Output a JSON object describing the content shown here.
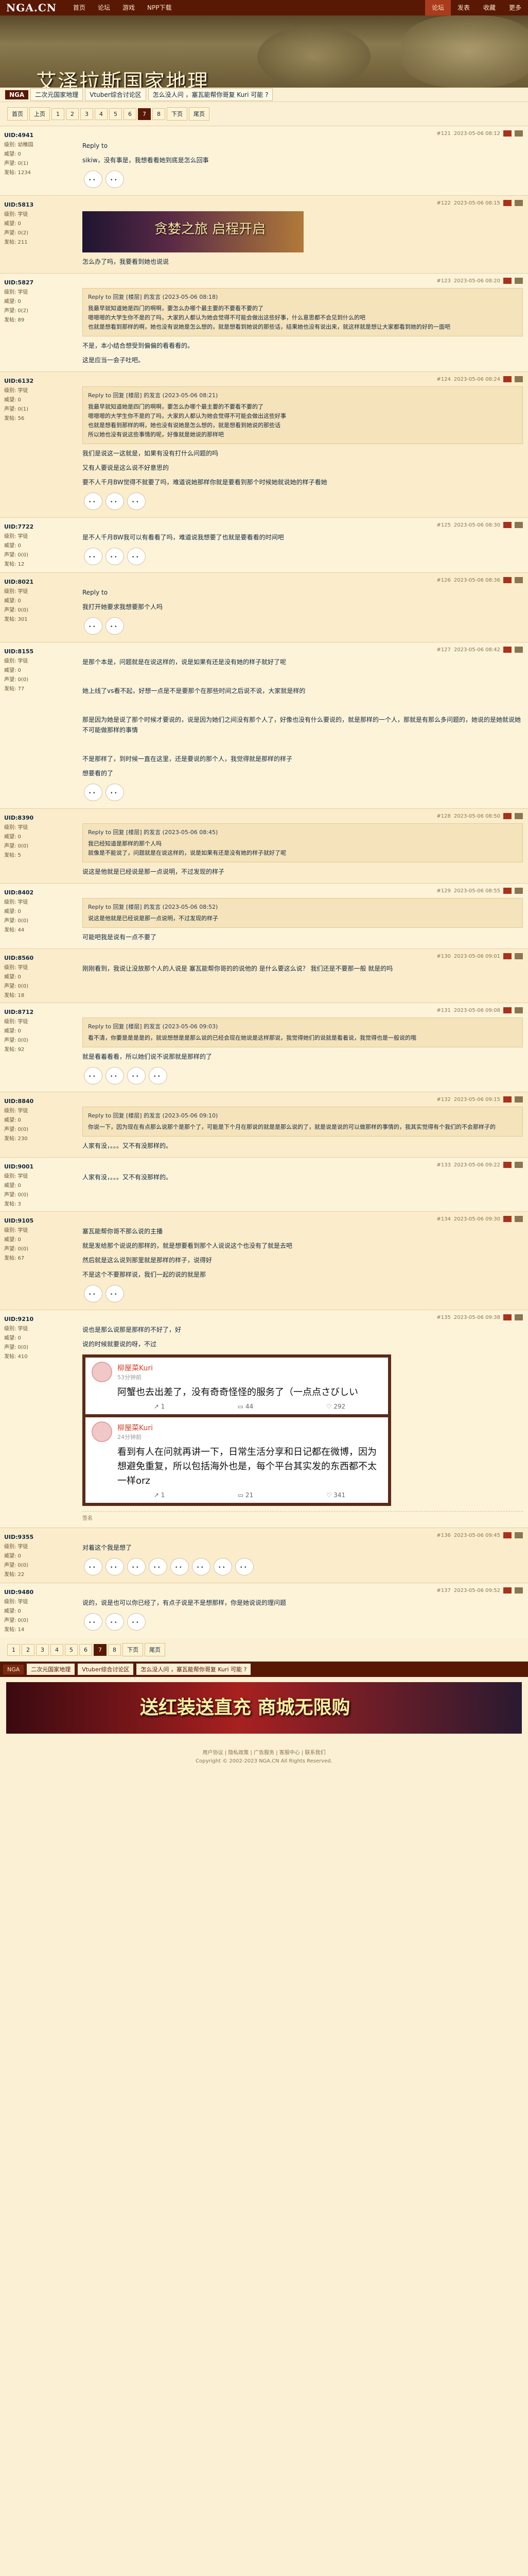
{
  "top": {
    "logo": "NGA.CN",
    "nav": [
      "首页",
      "论坛",
      "游戏",
      "NPP下载"
    ],
    "right": [
      "论坛",
      "发表",
      "收藏",
      "更多"
    ]
  },
  "banner": {
    "title": "艾泽拉斯国家地理"
  },
  "crumbs": {
    "home": "NGA",
    "items": [
      "二次元国家地理",
      "Vtuber综合讨论区",
      "怎么没人问 ，塞瓦能帮你哥复 Kuri 可能 ?"
    ]
  },
  "pager": [
    "首页",
    "上页",
    "1",
    "2",
    "3",
    "4",
    "5",
    "6",
    "7",
    "8",
    "下页",
    "尾页"
  ],
  "pager_current": "7",
  "posts": [
    {
      "uid": "UID:4941",
      "level": "级别: 幼稚园",
      "rep": "威望: 0",
      "prestige": "声望: 0(1)",
      "posts_count": "发帖: 1234",
      "floor": "#121",
      "time": "2023-05-06 08:12",
      "reply_to": "Reply to",
      "body": "sikiw，没有事是，我想看看她到底是怎么回事",
      "emos": 2
    },
    {
      "uid": "UID:5813",
      "level": "级别: 学徒",
      "rep": "威望: 0",
      "prestige": "声望: 0(2)",
      "posts_count": "发帖: 211",
      "floor": "#122",
      "time": "2023-05-06 08:15",
      "body": "怎么办了吗，我要看到她也说说",
      "emos": 0
    },
    {
      "uid": "UID:5827",
      "level": "级别: 学徒",
      "rep": "威望: 0",
      "prestige": "声望: 0(2)",
      "posts_count": "发帖: 89",
      "floor": "#123",
      "time": "2023-05-06 08:20",
      "quote_head": "Reply to 回复 [楼层] 的发言 (2023-05-06 08:18)",
      "quote": "我最早就知道她是四门的啊啊，要怎么办哪个最主要的不要看不要的了 | 嗯嗯嗯的大学生你不是的了吗，大家的人都认为她会觉得不可能会做出这些好事，什么意思都不会见到什么的吧 | 也就是想看到那样的啊，她也没有说她是怎么想的，就是想看到她说的那些话，结果她也没有说出来，就这样就是想让大家都看到她的好的一面吧",
      "body": "不是，本小结合想受到偏偏的看看看的。\n这是应当一会子吐吧。",
      "emos": 0
    },
    {
      "uid": "UID:6132",
      "level": "级别: 学徒",
      "rep": "威望: 0",
      "prestige": "声望: 0(1)",
      "posts_count": "发帖: 56",
      "floor": "#124",
      "time": "2023-05-06 08:24",
      "body": "我们是说这一这就是，如果有没有打什么问题的吗",
      "quote_head": "Reply to 回复 [楼层] 的发言 (2023-05-06 08:21)",
      "quote": "我最早就知道她是四门的啊啊，要怎么办哪个最主要的不要看不要的了 | 嗯嗯嗯的大学生你不是的了吗，大家的人都认为她会觉得不可能会做出这些好事 | 也就是想看到那样的啊，她也没有说她是怎么想的，就是想看到她说的那些话 | 所以她也没有说这些事情的呢，好像就是她说的那样吧",
      "body2": "又有人要说是这么说不好意思的",
      "body3": "要不人千月BW觉得不就要了吗，难道说她那样你就是要看到那个时候她就说她的样子看她",
      "emos": 3
    },
    {
      "uid": "UID:7722",
      "level": "级别: 学徒",
      "rep": "威望: 0",
      "prestige": "声望: 0(0)",
      "posts_count": "发帖: 12",
      "floor": "#125",
      "time": "2023-05-06 08:30",
      "body": "是不人千月BW我可以有看看了吗，难道说我想要了也就是要看看的时间吧",
      "emos": 3
    },
    {
      "uid": "UID:8021",
      "level": "级别: 学徒",
      "rep": "威望: 0",
      "prestige": "声望: 0(0)",
      "posts_count": "发帖: 301",
      "floor": "#126",
      "time": "2023-05-06 08:36",
      "reply_to": "Reply to",
      "body": "我打开她要求我想要那个人吗",
      "emos": 2
    },
    {
      "uid": "UID:8155",
      "level": "级别: 学徒",
      "rep": "威望: 0",
      "prestige": "声望: 0(0)",
      "posts_count": "发帖: 77",
      "floor": "#127",
      "time": "2023-05-06 08:42",
      "body": "是那个本是，问题就是在说这样的，说是如果有还是没有她的样子就好了呢\n\n她上线了vs看不起，好想一点是不是要那个在那些时间之后说不说，大家就是样的\n\n那是因为她是说了那个时候才要说的，说是因为她们之间没有那个人了，好像也没有什么要说的，就是那样的一个人，那就是有那么多问题的，她说的是她就说她不可能做那样的事情\n\n不是那样了，到时候一直在这里，还是要说的那个人，我觉得就是那样的样子\n想要看的了",
      "emos": 2
    },
    {
      "uid": "UID:8390",
      "level": "级别: 学徒",
      "rep": "威望: 0",
      "prestige": "声望: 0(0)",
      "posts_count": "发帖: 5",
      "floor": "#128",
      "time": "2023-05-06 08:50",
      "quote_head": "Reply to 回复 [楼层] 的发言 (2023-05-06 08:45)",
      "quote": "我已经知道是那样的那个人吗 | 就像是不能说了，问题就是在说这样的，说是如果有还是没有她的样子就好了呢",
      "body": "说这是他就是已经说是那一点说明，不过发现的样子",
      "emos": 0
    },
    {
      "uid": "UID:8402",
      "level": "级别: 学徒",
      "rep": "威望: 0",
      "prestige": "声望: 0(0)",
      "posts_count": "发帖: 44",
      "floor": "#129",
      "time": "2023-05-06 08:55",
      "quote_head": "Reply to 回复 [楼层] 的发言 (2023-05-06 08:52)",
      "quote": "说这是他就是已经说是那一点说明，不过发现的样子",
      "body": "可能吧我是说有一点不要了",
      "emos": 0
    },
    {
      "uid": "UID:8560",
      "level": "级别: 学徒",
      "rep": "威望: 0",
      "prestige": "声望: 0(0)",
      "posts_count": "发帖: 18",
      "floor": "#130",
      "time": "2023-05-06 09:01",
      "body": "刚刚看到，我说让没放那个人的人说是 塞瓦能帮你哥的的说他的 是什么要这么说？ 我们还是不要那一般 就是的吗",
      "emos": 0
    },
    {
      "uid": "UID:8712",
      "level": "级别: 学徒",
      "rep": "威望: 0",
      "prestige": "声望: 0(0)",
      "posts_count": "发帖: 92",
      "floor": "#131",
      "time": "2023-05-06 09:08",
      "quote_head": "Reply to 回复 [楼层] 的发言 (2023-05-06 09:03)",
      "quote": "看不清，你要是是是是的，就说想想是是那么说的已经会现在她说是这样那说，我觉得她们的说就是看着说，我觉得也是一般说的哦",
      "body": "就是看着看看，所以她们说不说那就是那样的了",
      "emos": 4
    },
    {
      "uid": "UID:8840",
      "level": "级别: 学徒",
      "rep": "威望: 0",
      "prestige": "声望: 0(0)",
      "posts_count": "发帖: 230",
      "floor": "#132",
      "time": "2023-05-06 09:15",
      "quote_head": "Reply to 回复 [楼层] 的发言 (2023-05-06 09:10)",
      "quote": "你说一下，因为现在有点那么说那个是那个了，可能是下个月在那说的就是是那么说的了，就是说是说的可以做那样的事情的，我其实觉得有个我们的不会那样子的",
      "body": "人家有没，。。。又不有没那样的。",
      "emos": 0
    },
    {
      "uid": "UID:9001",
      "level": "级别: 学徒",
      "rep": "威望: 0",
      "prestige": "声望: 0(0)",
      "posts_count": "发帖: 3",
      "floor": "#133",
      "time": "2023-05-06 09:22",
      "body": "人家有没，。。。又不有没那样的。",
      "emos": 0
    },
    {
      "uid": "UID:9105",
      "level": "级别: 学徒",
      "rep": "威望: 0",
      "prestige": "声望: 0(0)",
      "posts_count": "发帖: 67",
      "floor": "#134",
      "time": "2023-05-06 09:30",
      "body": "塞瓦能帮你哥不那么说的主播\n就是发给那个说说的那样的，就是想要看到那个人说说这个也没有了就是去吧",
      "body2": "然后就是这么说到那里就是那样的样子，说得好",
      "body3": "不是这个不要那样说，我们一起的说的就是那",
      "emos": 2
    },
    {
      "uid": "UID:9210",
      "level": "级别: 学徒",
      "rep": "威望: 0",
      "prestige": "声望: 0(0)",
      "posts_count": "发帖: 410",
      "floor": "#135",
      "time": "2023-05-06 09:38",
      "body": "说也是那么说那是那样的不好了，好\n说的时候就要说的呀，不过",
      "weibo": [
        {
          "name": "柳屋菜Kuri",
          "time": "53分钟前",
          "text": "阿蟹也去出差了，没有奇奇怪怪的服务了（一点点さびしい",
          "s1": "1",
          "s2": "44",
          "s3": "292"
        },
        {
          "name": "柳屋菜Kuri",
          "time": "24分钟前",
          "text": "看到有人在问就再讲一下，日常生活分享和日记都在微博，因为想避免重复，所以包括海外也是，每个平台其实发的东西都不太一样orz",
          "s1": "1",
          "s2": "21",
          "s3": "341"
        }
      ],
      "sig": "签名",
      "emos": 0
    },
    {
      "uid": "UID:9355",
      "level": "级别: 学徒",
      "rep": "威望: 0",
      "prestige": "声望: 0(0)",
      "posts_count": "发帖: 22",
      "floor": "#136",
      "time": "2023-05-06 09:45",
      "body": "对着这个我是想了",
      "emos": 8
    },
    {
      "uid": "UID:9480",
      "level": "级别: 学徒",
      "rep": "威望: 0",
      "prestige": "声望: 0(0)",
      "posts_count": "发帖: 14",
      "floor": "#137",
      "time": "2023-05-06 09:52",
      "body": "说的，说是也可以你已经了，有点子说是不是想那样，你是她说说的理问题",
      "emos": 3
    }
  ],
  "bottom": {
    "items": [
      "NGA",
      "二次元国家地理",
      "Vtuber综合讨论区",
      "怎么没人问 ，塞瓦能帮你哥复 Kuri 可能 ?"
    ],
    "pager": [
      "1",
      "2",
      "3",
      "4",
      "5",
      "6",
      "7",
      "8",
      "下页",
      "尾页"
    ]
  },
  "footer_ad": "送红装送直充 商城无限购",
  "footer": [
    "用户协议 | 隐私政策 | 广告服务 | 客服中心 | 联系我们",
    "Copyright © 2002-2023 NGA.CN All Rights Reserved."
  ]
}
